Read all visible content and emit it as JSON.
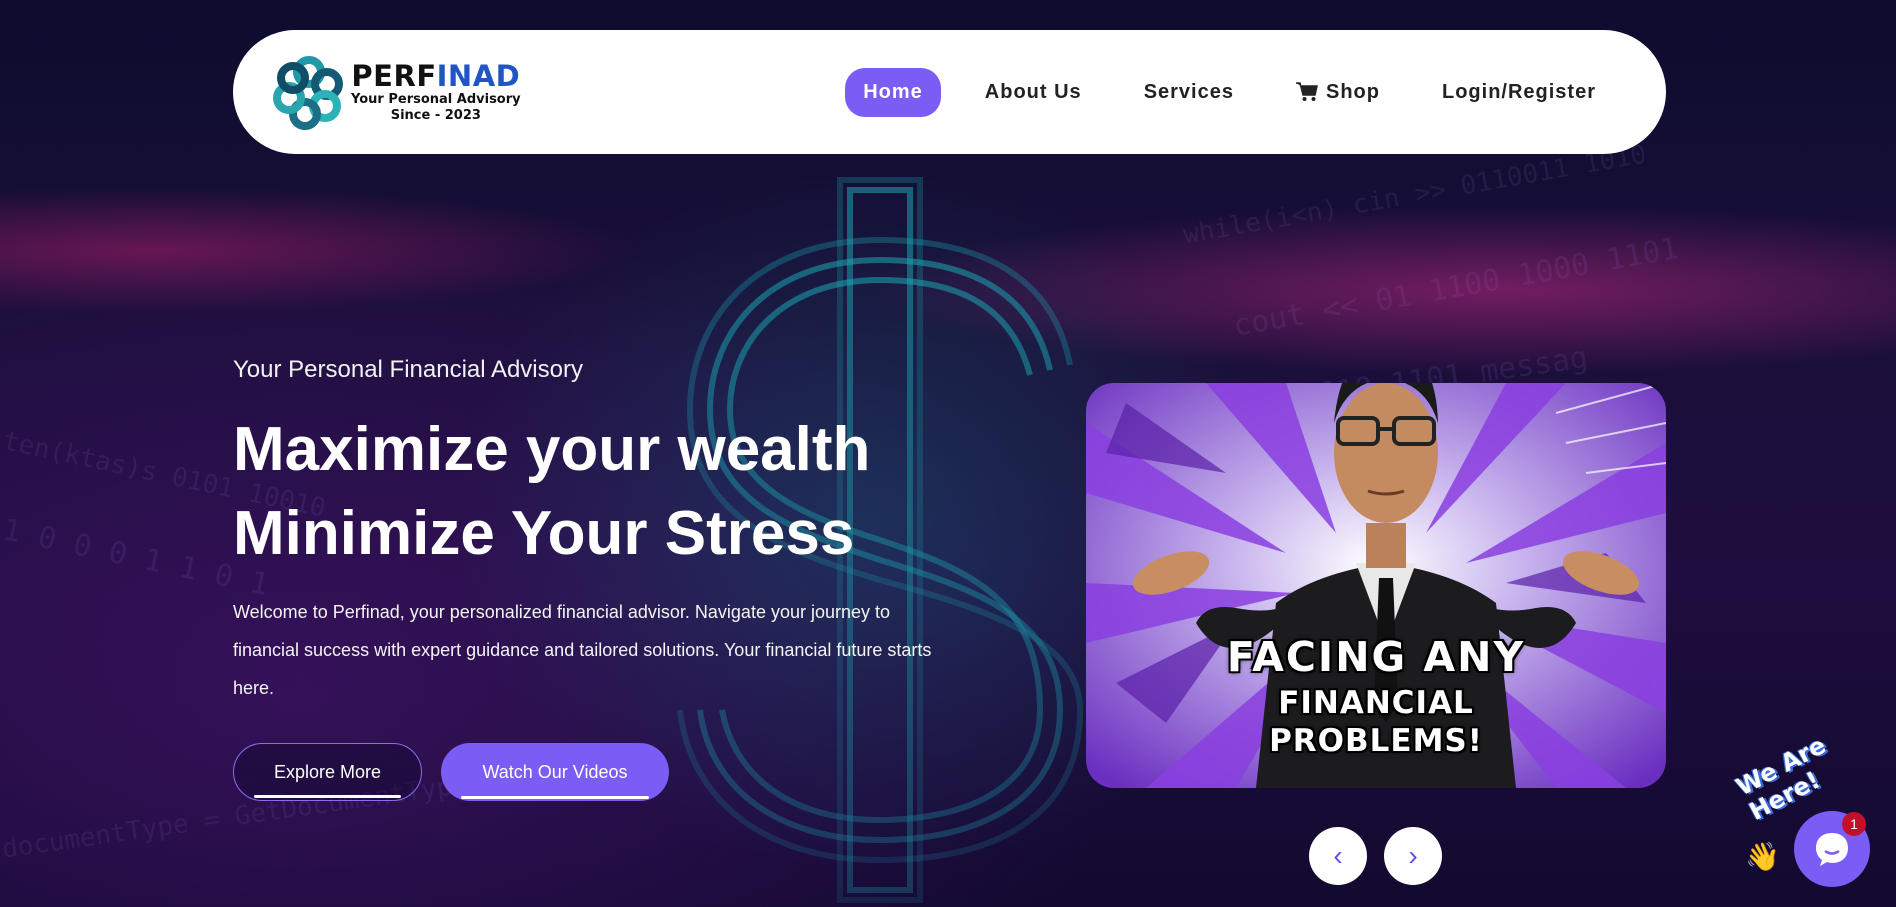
{
  "brand": {
    "name_part1": "PERF",
    "name_part2": "INAD",
    "tagline": "Your Personal Advisory",
    "since": "Since - 2023"
  },
  "nav": {
    "items": [
      {
        "label": "Home",
        "active": true
      },
      {
        "label": "About Us",
        "active": false
      },
      {
        "label": "Services",
        "active": false
      },
      {
        "label": "Shop",
        "active": false,
        "icon": "cart-icon"
      },
      {
        "label": "Login/Register",
        "active": false
      }
    ]
  },
  "hero": {
    "eyebrow": "Your Personal Financial Advisory",
    "headline_line1": "Maximize your wealth",
    "headline_line2": "Minimize Your Stress",
    "description": "Welcome to Perfinad, your personalized financial advisor. Navigate your journey to financial success with expert guidance and tailored solutions. Your financial future starts here.",
    "explore_label": "Explore More",
    "videos_label": "Watch Our Videos",
    "image_caption_line1": "FACING ANY",
    "image_caption_line2": "FINANCIAL",
    "image_caption_line3": "PROBLEMS!"
  },
  "slider": {
    "prev_label": "‹",
    "next_label": "›"
  },
  "chat": {
    "tag": "We Are Here!",
    "badge_count": "1",
    "wave_icon": "👋"
  },
  "colors": {
    "accent": "#7b5cf5",
    "brand_blue": "#1f56c4",
    "badge_red": "#c0102a"
  }
}
